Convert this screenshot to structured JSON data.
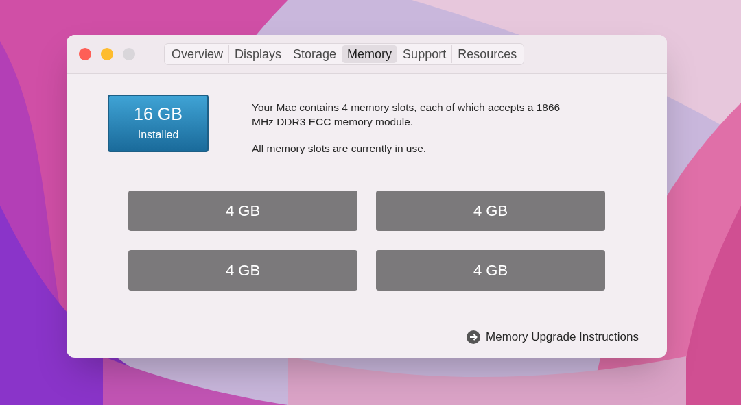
{
  "window": {
    "controls": [
      {
        "color": "#fe5f57"
      },
      {
        "color": "#febc2e"
      },
      {
        "color": "#d9d6da"
      }
    ]
  },
  "tabs": [
    {
      "label": "Overview",
      "selected": false
    },
    {
      "label": "Displays",
      "selected": false
    },
    {
      "label": "Storage",
      "selected": false
    },
    {
      "label": "Memory",
      "selected": true
    },
    {
      "label": "Support",
      "selected": false
    },
    {
      "label": "Resources",
      "selected": false
    }
  ],
  "memory": {
    "size": "16 GB",
    "label": "Installed"
  },
  "description": [
    "Your Mac contains 4 memory slots, each of which accepts a 1866 MHz DDR3 ECC memory module.",
    "All memory slots are currently in use."
  ],
  "slots": [
    {
      "label": "4 GB"
    },
    {
      "label": "4 GB"
    },
    {
      "label": "4 GB"
    },
    {
      "label": "4 GB"
    }
  ],
  "link": {
    "label": "Memory Upgrade Instructions"
  }
}
